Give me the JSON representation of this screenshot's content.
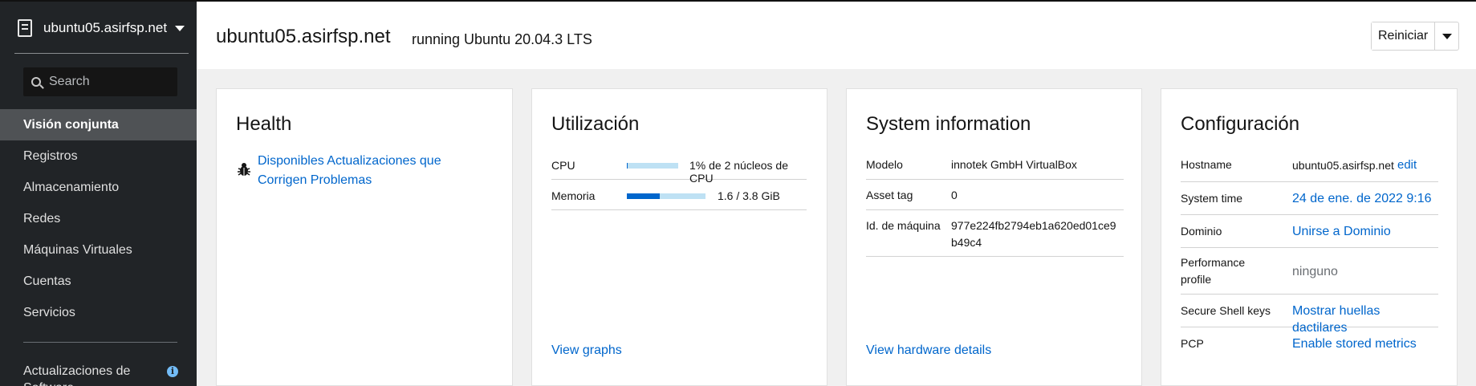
{
  "sidebar": {
    "host": "ubuntu05.asirfsp.net",
    "search_placeholder": "Search",
    "nav": [
      {
        "label": "Visión conjunta",
        "active": true
      },
      {
        "label": "Registros"
      },
      {
        "label": "Almacenamiento"
      },
      {
        "label": "Redes"
      },
      {
        "label": "Máquinas Virtuales"
      },
      {
        "label": "Cuentas"
      },
      {
        "label": "Servicios"
      }
    ],
    "updates_label": "Actualizaciones de Software",
    "updates_badge": "i"
  },
  "header": {
    "title": "ubuntu05.asirfsp.net",
    "subtitle": "running Ubuntu 20.04.3 LTS",
    "restart_label": "Reiniciar"
  },
  "health": {
    "title": "Health",
    "link": "Disponibles Actualizaciones que Corrigen Problemas"
  },
  "usage": {
    "title": "Utilización",
    "cpu_label": "CPU",
    "cpu_value": "1% de 2 núcleos de CPU",
    "cpu_fraction": 0.01,
    "memory_label": "Memoria",
    "memory_value": "1.6 / 3.8 GiB",
    "memory_fraction": 0.42,
    "link": "View graphs"
  },
  "sysinfo": {
    "title": "System information",
    "model_label": "Modelo",
    "model_value": "innotek GmbH VirtualBox",
    "asset_label": "Asset tag",
    "asset_value": "0",
    "machine_label": "Id. de máquina",
    "machine_value": "977e224fb2794eb1a620ed01ce9b49c4",
    "link": "View hardware details"
  },
  "config": {
    "title": "Configuración",
    "hostname_label": "Hostname",
    "hostname_value": "ubuntu05.asirfsp.net",
    "hostname_edit": "edit",
    "time_label": "System time",
    "time_value": "24 de ene. de 2022 9:16",
    "domain_label": "Dominio",
    "domain_value": "Unirse a Dominio",
    "perf_label": "Performance profile",
    "perf_value": "ninguno",
    "ssh_label": "Secure Shell keys",
    "ssh_value": "Mostrar huellas dactilares",
    "pcp_label": "PCP",
    "pcp_value": "Enable stored metrics"
  },
  "colors": {
    "sidebar_bg": "#212427",
    "link": "#0066cc",
    "bar_track": "#bee1f4",
    "bar_fill": "#0066cc"
  }
}
